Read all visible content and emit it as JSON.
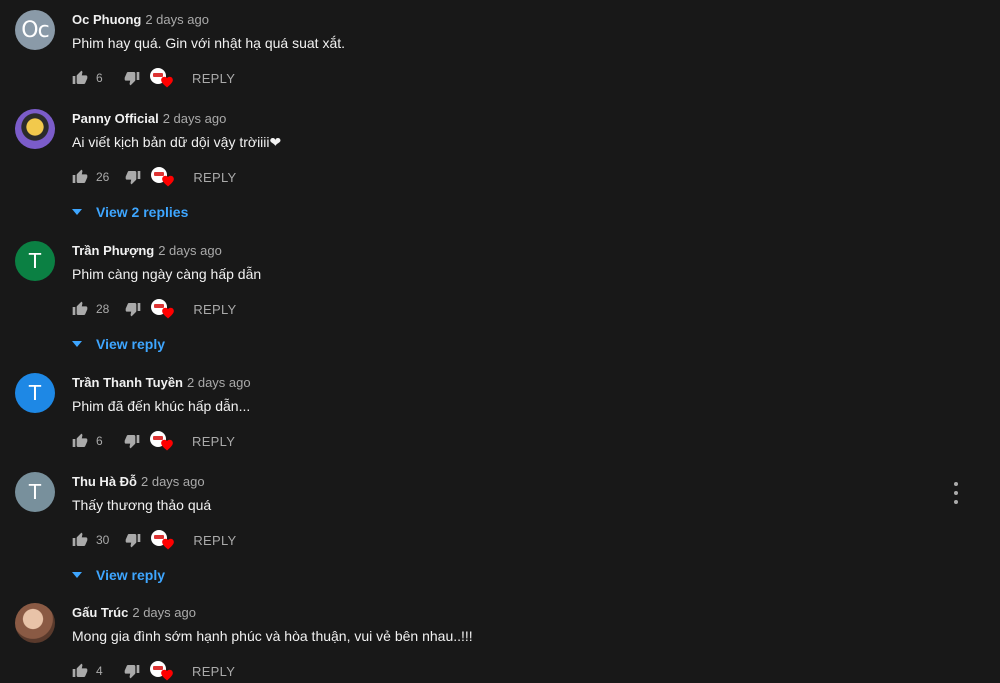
{
  "comments": [
    {
      "author": "Oc Phuong",
      "time": "2 days ago",
      "text": "Phim hay quá. Gin với nhật hạ quá suat xắt.",
      "likes": "6",
      "reply_label": "REPLY",
      "avatar": {
        "initials": "Oc",
        "color": "#8a9aa8"
      },
      "view_replies": null
    },
    {
      "author": "Panny Official",
      "time": "2 days ago",
      "text": "Ai viết kịch bản dữ dội vậy trờiiii❤",
      "likes": "26",
      "reply_label": "REPLY",
      "avatar": {
        "initials": "",
        "color": "#6a4fb0"
      },
      "view_replies": "View 2 replies"
    },
    {
      "author": "Trần Phượng",
      "time": "2 days ago",
      "text": "Phim càng ngày càng hấp dẫn",
      "likes": "28",
      "reply_label": "REPLY",
      "avatar": {
        "initials": "T",
        "color": "#0b8043"
      },
      "view_replies": "View reply"
    },
    {
      "author": "Trần Thanh Tuyền",
      "time": "2 days ago",
      "text": "Phim đã đến khúc hấp dẫn...",
      "likes": "6",
      "reply_label": "REPLY",
      "avatar": {
        "initials": "T",
        "color": "#1e88e5"
      },
      "view_replies": null
    },
    {
      "author": "Thu Hà Đỗ",
      "time": "2 days ago",
      "text": "Thấy thương thảo quá",
      "likes": "30",
      "reply_label": "REPLY",
      "avatar": {
        "initials": "T",
        "color": "#78909c"
      },
      "view_replies": "View reply"
    },
    {
      "author": "Gấu Trúc",
      "time": "2 days ago",
      "text": "Mong gia đình sớm hạnh phúc và hòa thuận, vui vẻ bên nhau..!!!",
      "likes": "4",
      "reply_label": "REPLY",
      "avatar": {
        "initials": "",
        "color": "#a0705a"
      },
      "view_replies": null
    }
  ],
  "icons": {
    "like": "thumb-up-icon",
    "dislike": "thumb-down-icon",
    "creator_heart": "creator-heart-icon",
    "expand": "caret-down-icon",
    "menu": "more-vert-icon"
  },
  "colors": {
    "background": "#181818",
    "link": "#3ea6ff",
    "heart": "#ff0000",
    "secondary_text": "#aaaaaa"
  }
}
